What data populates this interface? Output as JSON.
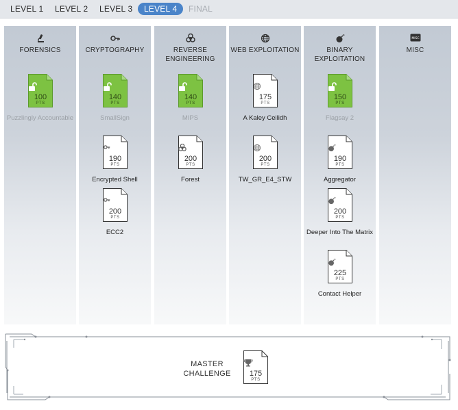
{
  "tabs": [
    {
      "label": "LEVEL 1",
      "state": "normal"
    },
    {
      "label": "LEVEL 2",
      "state": "normal"
    },
    {
      "label": "LEVEL 3",
      "state": "normal"
    },
    {
      "label": "LEVEL 4",
      "state": "active"
    },
    {
      "label": "FINAL",
      "state": "disabled"
    }
  ],
  "categories": [
    {
      "title": "FORENSICS",
      "icon": "microscope-icon",
      "challenges": [
        {
          "name": "Puzzlingly Accountable",
          "points": "100",
          "pts_label": "PTS",
          "solved": true
        }
      ]
    },
    {
      "title": "CRYPTOGRAPHY",
      "icon": "key-icon",
      "challenges": [
        {
          "name": "SmallSign",
          "points": "140",
          "pts_label": "PTS",
          "solved": true
        },
        {
          "name": "Encrypted Shell",
          "points": "190",
          "pts_label": "PTS",
          "solved": false
        },
        {
          "name": "ECC2",
          "points": "200",
          "pts_label": "PTS",
          "solved": false
        }
      ]
    },
    {
      "title": "REVERSE ENGINEERING",
      "icon": "biohazard-icon",
      "challenges": [
        {
          "name": "MIPS",
          "points": "140",
          "pts_label": "PTS",
          "solved": true
        },
        {
          "name": "Forest",
          "points": "200",
          "pts_label": "PTS",
          "solved": false
        }
      ]
    },
    {
      "title": "WEB EXPLOITATION",
      "icon": "globe-icon",
      "challenges": [
        {
          "name": "A Kaley Ceilidh",
          "points": "175",
          "pts_label": "PTS",
          "solved": false
        },
        {
          "name": "TW_GR_E4_STW",
          "points": "200",
          "pts_label": "PTS",
          "solved": false
        }
      ]
    },
    {
      "title": "BINARY EXPLOITATION",
      "icon": "bomb-icon",
      "challenges": [
        {
          "name": "Flagsay 2",
          "points": "150",
          "pts_label": "PTS",
          "solved": true
        },
        {
          "name": "Aggregator",
          "points": "190",
          "pts_label": "PTS",
          "solved": false
        },
        {
          "name": "Deeper Into The Matrix",
          "points": "200",
          "pts_label": "PTS",
          "solved": false
        },
        {
          "name": "Contact Helper",
          "points": "225",
          "pts_label": "PTS",
          "solved": false
        }
      ]
    },
    {
      "title": "MISC",
      "icon": "misc-icon",
      "icon_text": "MISC",
      "challenges": []
    }
  ],
  "master": {
    "label": "MASTER CHALLENGE",
    "points": "175",
    "pts_label": "PTS",
    "icon": "trophy-icon"
  },
  "colors": {
    "active_tab": "#4a84c9",
    "solved": "#7dc242",
    "column_top": "#c2cad4"
  }
}
